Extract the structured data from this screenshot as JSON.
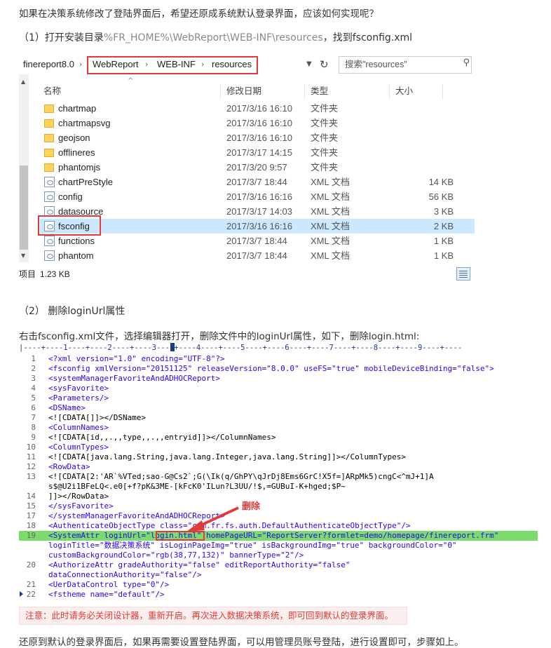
{
  "intro": {
    "question": "如果在决策系统修改了登陆界面后，希望还原成系统默认登录界面，应该如何实现呢？",
    "step1_prefix": "（1）打开安装目录",
    "step1_path": "%FR_HOME%\\WebReport\\WEB-INF\\resources",
    "step1_suffix": "，找到fsconfig.xml"
  },
  "explorer": {
    "breadcrumb": [
      "finereport8.0",
      "WebReport",
      "WEB-INF",
      "resources"
    ],
    "search_placeholder": "搜索\"resources\"",
    "columns": {
      "name": "名称",
      "modified": "修改日期",
      "type": "类型",
      "size": "大小"
    },
    "rows": [
      {
        "name": "chartmap",
        "date": "2017/3/16 16:10",
        "type": "文件夹",
        "size": "",
        "kind": "folder"
      },
      {
        "name": "chartmapsvg",
        "date": "2017/3/16 16:10",
        "type": "文件夹",
        "size": "",
        "kind": "folder"
      },
      {
        "name": "geojson",
        "date": "2017/3/16 16:10",
        "type": "文件夹",
        "size": "",
        "kind": "folder"
      },
      {
        "name": "offlineres",
        "date": "2017/3/17 14:15",
        "type": "文件夹",
        "size": "",
        "kind": "folder"
      },
      {
        "name": "phantomjs",
        "date": "2017/3/20 9:57",
        "type": "文件夹",
        "size": "",
        "kind": "folder"
      },
      {
        "name": "chartPreStyle",
        "date": "2017/3/7 18:44",
        "type": "XML 文档",
        "size": "14 KB",
        "kind": "xml"
      },
      {
        "name": "config",
        "date": "2017/3/16 16:16",
        "type": "XML 文档",
        "size": "56 KB",
        "kind": "xml"
      },
      {
        "name": "datasource",
        "date": "2017/3/17 14:03",
        "type": "XML 文档",
        "size": "3 KB",
        "kind": "xml"
      },
      {
        "name": "fsconfig",
        "date": "2017/3/16 16:16",
        "type": "XML 文档",
        "size": "2 KB",
        "kind": "xml",
        "selected": true
      },
      {
        "name": "functions",
        "date": "2017/3/7 18:44",
        "type": "XML 文档",
        "size": "1 KB",
        "kind": "xml"
      },
      {
        "name": "phantom",
        "date": "2017/3/7 18:44",
        "type": "XML 文档",
        "size": "1 KB",
        "kind": "xml"
      }
    ],
    "status": {
      "label": "项目",
      "size": "1.23 KB"
    },
    "icons": {
      "dropdown": "chevron-down-icon",
      "refresh": "refresh-icon",
      "search": "search-icon",
      "view": "details-view-icon",
      "sort": "sort-up-icon"
    }
  },
  "step2": {
    "heading": "（2） 删除loginUrl属性",
    "desc": "右击fsconfig.xml文件，选择编辑器打开，删除文件中的loginUrl属性，如下，删除login.html:"
  },
  "editor": {
    "ruler": "|----+----1----+----2----+----3----+----4----+----5----+----6----+----7----+----8----+----9----+----",
    "annotation": "删除",
    "lines": [
      {
        "n": "1",
        "t": "<?xml version=\"1.0\" encoding=\"UTF-8\"?>"
      },
      {
        "n": "2",
        "t": "<fsconfig xmlVersion=\"20151125\" releaseVersion=\"8.0.0\" useFS=\"true\" mobileDeviceBinding=\"false\">"
      },
      {
        "n": "3",
        "t": "<systemManagerFavoriteAndADHOCReport>"
      },
      {
        "n": "4",
        "t": "<sysFavorite>"
      },
      {
        "n": "5",
        "t": "<Parameters/>"
      },
      {
        "n": "6",
        "t": "<DSName>"
      },
      {
        "n": "7",
        "t": "<![CDATA[]]></DSName>"
      },
      {
        "n": "8",
        "t": "<ColumnNames>"
      },
      {
        "n": "9",
        "t": "<![CDATA[id,,.,,type,,.,,entryid]]></ColumnNames>"
      },
      {
        "n": "10",
        "t": "<ColumnTypes>"
      },
      {
        "n": "11",
        "t": "<![CDATA[java.lang.String,java.lang.Integer,java.lang.String]]></ColumnTypes>"
      },
      {
        "n": "12",
        "t": "<RowData>"
      },
      {
        "n": "13",
        "t": "<![CDATA[2:'AR`%VTed;sao-G@Cs2`;G(\\Ik(q/GhPY\\qJrDj8Ems6GrC!X5f=]ARpMk5)cngC<^mJ+1]A"
      },
      {
        "n": "",
        "t": "s$@U2i1BFeLQ<.e0[+f?pK&3ME-[kFcK0'ILun?L3UU/!$,=GUBuI-K+hged;$P~"
      },
      {
        "n": "14",
        "t": "]]></RowData>"
      },
      {
        "n": "15",
        "t": "</sysFavorite>"
      },
      {
        "n": "17",
        "t": "</systemManagerFavoriteAndADHOCReport>"
      },
      {
        "n": "18",
        "t": "<AuthenticateObjectType class=\"com.fr.fs.auth.DefaultAuthenticateObjectType\"/>"
      },
      {
        "n": "19",
        "t": "<SystemAttr loginUrl=\"login.html\" homePageURL=\"ReportServer?formlet=demo/homepage/finereport.frm\"",
        "hl": true
      },
      {
        "n": "",
        "t": "loginTitle=\"数据决策系统\" isLoginPageImg=\"true\" isBackgroundImg=\"true\" backgroundColor=\"0\""
      },
      {
        "n": "",
        "t": "customBackgroundColor=\"rgb(38,77,132)\" bannerType=\"2\"/>"
      },
      {
        "n": "20",
        "t": "<AuthorizeAttr gradeAuthority=\"false\" editReportAuthority=\"false\""
      },
      {
        "n": "",
        "t": "dataConnectionAuthority=\"false\"/>"
      },
      {
        "n": "21",
        "t": "<UerDataControl type=\"0\"/>"
      },
      {
        "n": "22",
        "t": "<fstheme name=\"default\"/>"
      }
    ]
  },
  "note": "注意：此时请务必关闭设计器，重新开启。再次进入数据决策系统，即可回到默认的登录界面。",
  "footer": "还原到默认的登录界面后，如果再需要设置登陆界面，可以用管理员账号登陆，进行设置即可，步骤如上。"
}
